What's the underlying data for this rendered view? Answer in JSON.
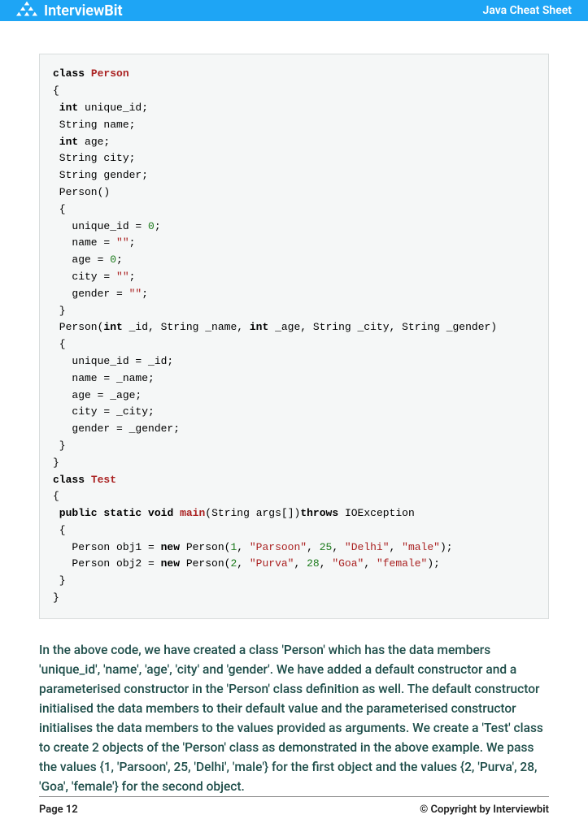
{
  "header": {
    "brand_prefix": "Interview",
    "brand_suffix": "Bit",
    "title": "Java Cheat Sheet"
  },
  "code": {
    "t01": "class",
    "t02": "Person",
    "t03": "{",
    "t04": " int",
    "t05": " unique_id;",
    "t06": " String name;",
    "t07": " int",
    "t08": " age;",
    "t09": " String city;",
    "t10": " String gender;",
    "t11": " Person()",
    "t12": " {",
    "t13": "   unique_id = ",
    "t14": "0",
    "t15": ";",
    "t16": "   name = ",
    "t17": "\"\"",
    "t18": ";",
    "t19": "   age = ",
    "t20": "0",
    "t21": ";",
    "t22": "   city = ",
    "t23": "\"\"",
    "t24": ";",
    "t25": "   gender = ",
    "t26": "\"\"",
    "t27": ";",
    "t28": " }",
    "t29": " Person(",
    "t30": "int",
    "t31": " _id, String _name, ",
    "t32": "int",
    "t33": " _age, String _city, String _gender)",
    "t34": " {",
    "t35": "   unique_id = _id;",
    "t36": "   name = _name;",
    "t37": "   age = _age;",
    "t38": "   city = _city;",
    "t39": "   gender = _gender;",
    "t40": " }",
    "t41": "}",
    "t42": "class",
    "t43": "Test",
    "t44": "{",
    "t45": " public",
    "t46": "static",
    "t47": "void",
    "t48": "main",
    "t49": "(String args[])",
    "t50": "throws",
    "t51": " IOException",
    "t52": " {",
    "t53": "   Person obj1 = ",
    "t54": "new",
    "t55": " Person(",
    "t56": "1",
    "t57": ", ",
    "t58": "\"Parsoon\"",
    "t59": ", ",
    "t60": "25",
    "t61": ", ",
    "t62": "\"Delhi\"",
    "t63": ", ",
    "t64": "\"male\"",
    "t65": ");",
    "t66": "   Person obj2 = ",
    "t67": "new",
    "t68": " Person(",
    "t69": "2",
    "t70": ", ",
    "t71": "\"Purva\"",
    "t72": ", ",
    "t73": "28",
    "t74": ", ",
    "t75": "\"Goa\"",
    "t76": ", ",
    "t77": "\"female\"",
    "t78": ");",
    "t79": " }",
    "t80": "}"
  },
  "paragraph": "In the above code, we have created a class 'Person' which has the data members 'unique_id', 'name', 'age', 'city' and 'gender'. We have added a default constructor and a parameterised constructor in the 'Person' class definition as well. The default constructor initialised the data members to their default value and the parameterised constructor initialises the data members to the values provided as arguments. We create a 'Test' class to create 2 objects of the 'Person' class as demonstrated in the above example. We pass the values {1, 'Parsoon', 25, 'Delhi', 'male'} for the first object and the values {2, 'Purva', 28, 'Goa', 'female'} for the second object.",
  "footer": {
    "page": "Page 12",
    "copyright": "© Copyright by Interviewbit"
  }
}
